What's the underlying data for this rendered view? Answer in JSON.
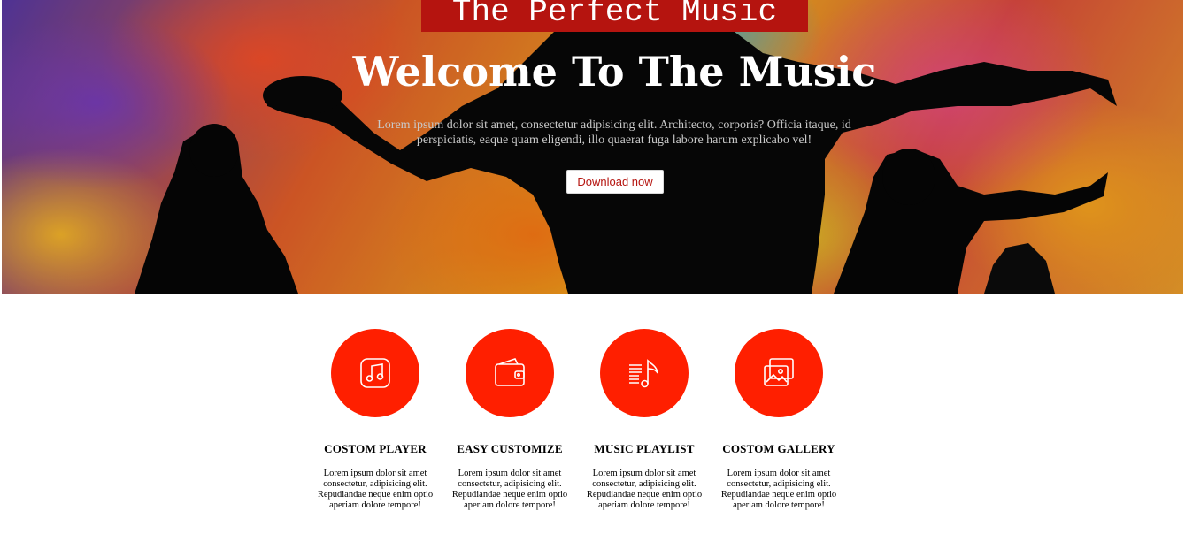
{
  "hero": {
    "brand": "The Perfect Music",
    "headline": "Welcome To The Music",
    "lead": "Lorem ipsum dolor sit amet, consectetur adipisicing elit. Architecto, corporis? Officia itaque, id perspiciatis, eaque quam eligendi, illo quaerat fuga labore harum explicabo vel!",
    "cta_label": "Download now"
  },
  "features": [
    {
      "icon": "music-note-icon",
      "title": "COSTOM PLAYER",
      "text": "Lorem ipsum dolor sit amet consectetur, adipisicing elit. Repudiandae neque enim optio aperiam dolore tempore!"
    },
    {
      "icon": "wallet-icon",
      "title": "EASY CUSTOMIZE",
      "text": "Lorem ipsum dolor sit amet consectetur, adipisicing elit. Repudiandae neque enim optio aperiam dolore tempore!"
    },
    {
      "icon": "playlist-icon",
      "title": "MUSIC PLAYLIST",
      "text": "Lorem ipsum dolor sit amet consectetur, adipisicing elit. Repudiandae neque enim optio aperiam dolore tempore!"
    },
    {
      "icon": "gallery-icon",
      "title": "COSTOM GALLERY",
      "text": "Lorem ipsum dolor sit amet consectetur, adipisicing elit. Repudiandae neque enim optio aperiam dolore tempore!"
    }
  ],
  "colors": {
    "accent": "#ff1f00",
    "brand_bg": "#b5140f"
  }
}
